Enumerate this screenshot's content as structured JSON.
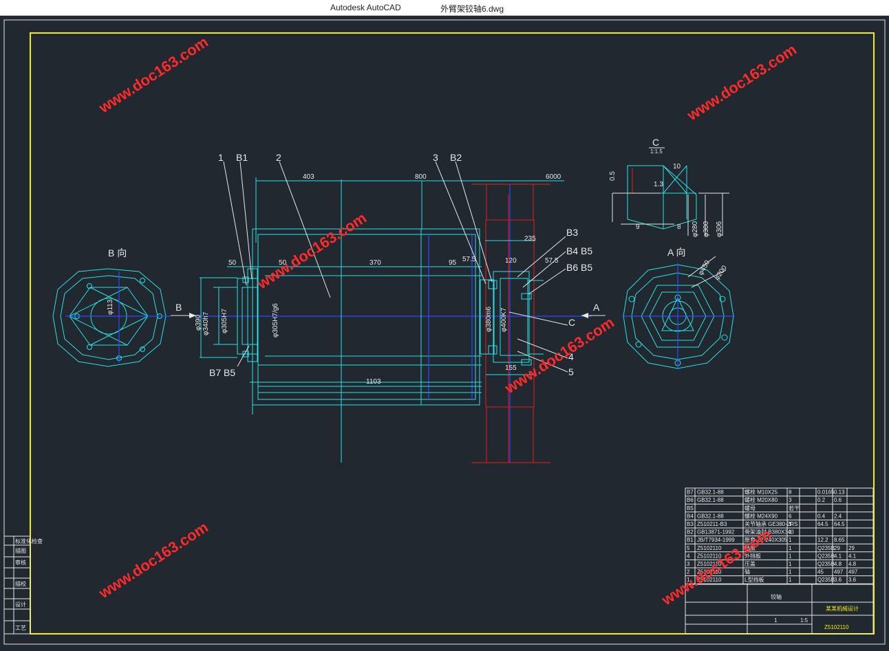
{
  "window": {
    "app_name": "Autodesk AutoCAD",
    "document_name": "外臂架铰轴6.dwg"
  },
  "watermark": "www.doc163.com",
  "colors": {
    "background": "#212830",
    "frame": "#f0f000",
    "geometry": "#27e3e3",
    "centerline": "#2b4cff",
    "hidden": "#e02020",
    "text": "#e8e8e8",
    "watermark": "#ff2a2a"
  },
  "views": {
    "view_b": "B 向",
    "view_a": "A 向",
    "view_c": "C",
    "view_c_scale": "1:1.5",
    "arrow_b": "B",
    "arrow_a": "A",
    "arrow_c": "C"
  },
  "balloons": [
    "1",
    "B1",
    "2",
    "3",
    "B2",
    "B3",
    "B4 B5",
    "B6 B5",
    "C",
    "4",
    "5",
    "B7 B5"
  ],
  "dimensions": {
    "d403": "403",
    "d800": "800",
    "d6000": "6000",
    "d235": "235",
    "d50a": "50",
    "d50b": "50",
    "d370": "370",
    "d95": "95",
    "d575a": "57.5",
    "d120": "120",
    "d575b": "57.5",
    "d155": "155",
    "d1103": "1103",
    "d390": "φ390",
    "d340": "φ340h7",
    "d305h7": "φ305H7",
    "d305g6": "φ305H7/g6",
    "d380": "φ380m6",
    "d400": "φ400K7",
    "d113": "φ113",
    "c05": "0.5",
    "c9": "9",
    "c8": "8",
    "c10": "10",
    "c13": "1.3",
    "c280": "φ280",
    "c300": "φ300",
    "c306": "φ306",
    "a450": "φ450",
    "a200": "φ200"
  },
  "bom": {
    "rows": [
      [
        "B7",
        "GB32.1-88",
        "螺栓 M10X25",
        "8",
        "0.0165",
        "0.13"
      ],
      [
        "B6",
        "GB32.1-88",
        "螺栓 M20X80",
        "3",
        "0.2",
        "0.6"
      ],
      [
        "B5",
        "",
        "螺母",
        "若干",
        "",
        ""
      ],
      [
        "B4",
        "GB32.1-88",
        "螺栓 M24X90",
        "6",
        "0.4",
        "2.4"
      ],
      [
        "B3",
        "Z510211-B3",
        "关节轴承 GE380-2RS",
        "1",
        "64.5",
        "64.5"
      ],
      [
        "B2",
        "GB13871-1992",
        "骨架油封 B380X340",
        "1",
        "",
        ""
      ],
      [
        "B1",
        "JB/T7934-1999",
        "胀套 Z2-240X305",
        "1",
        "12.2",
        "8.65"
      ],
      [
        "5",
        "Z5102110",
        "挡板",
        "1",
        "Q235B",
        "29",
        "29"
      ],
      [
        "4",
        "Z5102110",
        "外挡板",
        "1",
        "Q235B",
        "4.1",
        "4.1"
      ],
      [
        "3",
        "Z5102110",
        "压盖",
        "1",
        "Q235B",
        "4.8",
        "4.8"
      ],
      [
        "2",
        "Z5102110",
        "轴",
        "1",
        "45",
        "497",
        "497"
      ],
      [
        "1",
        "Z5102110",
        "L型挡板",
        "1",
        "Q235B",
        "3.6",
        "3.6"
      ]
    ],
    "drawing_title": "铰轴",
    "scale": "1:5",
    "drawing_number": "Z5102110",
    "company": "某某机械设计",
    "sheet_count": "1"
  },
  "left_strip": [
    "标准化检查",
    "描图",
    "审核",
    "描校",
    "设计",
    "工艺"
  ]
}
